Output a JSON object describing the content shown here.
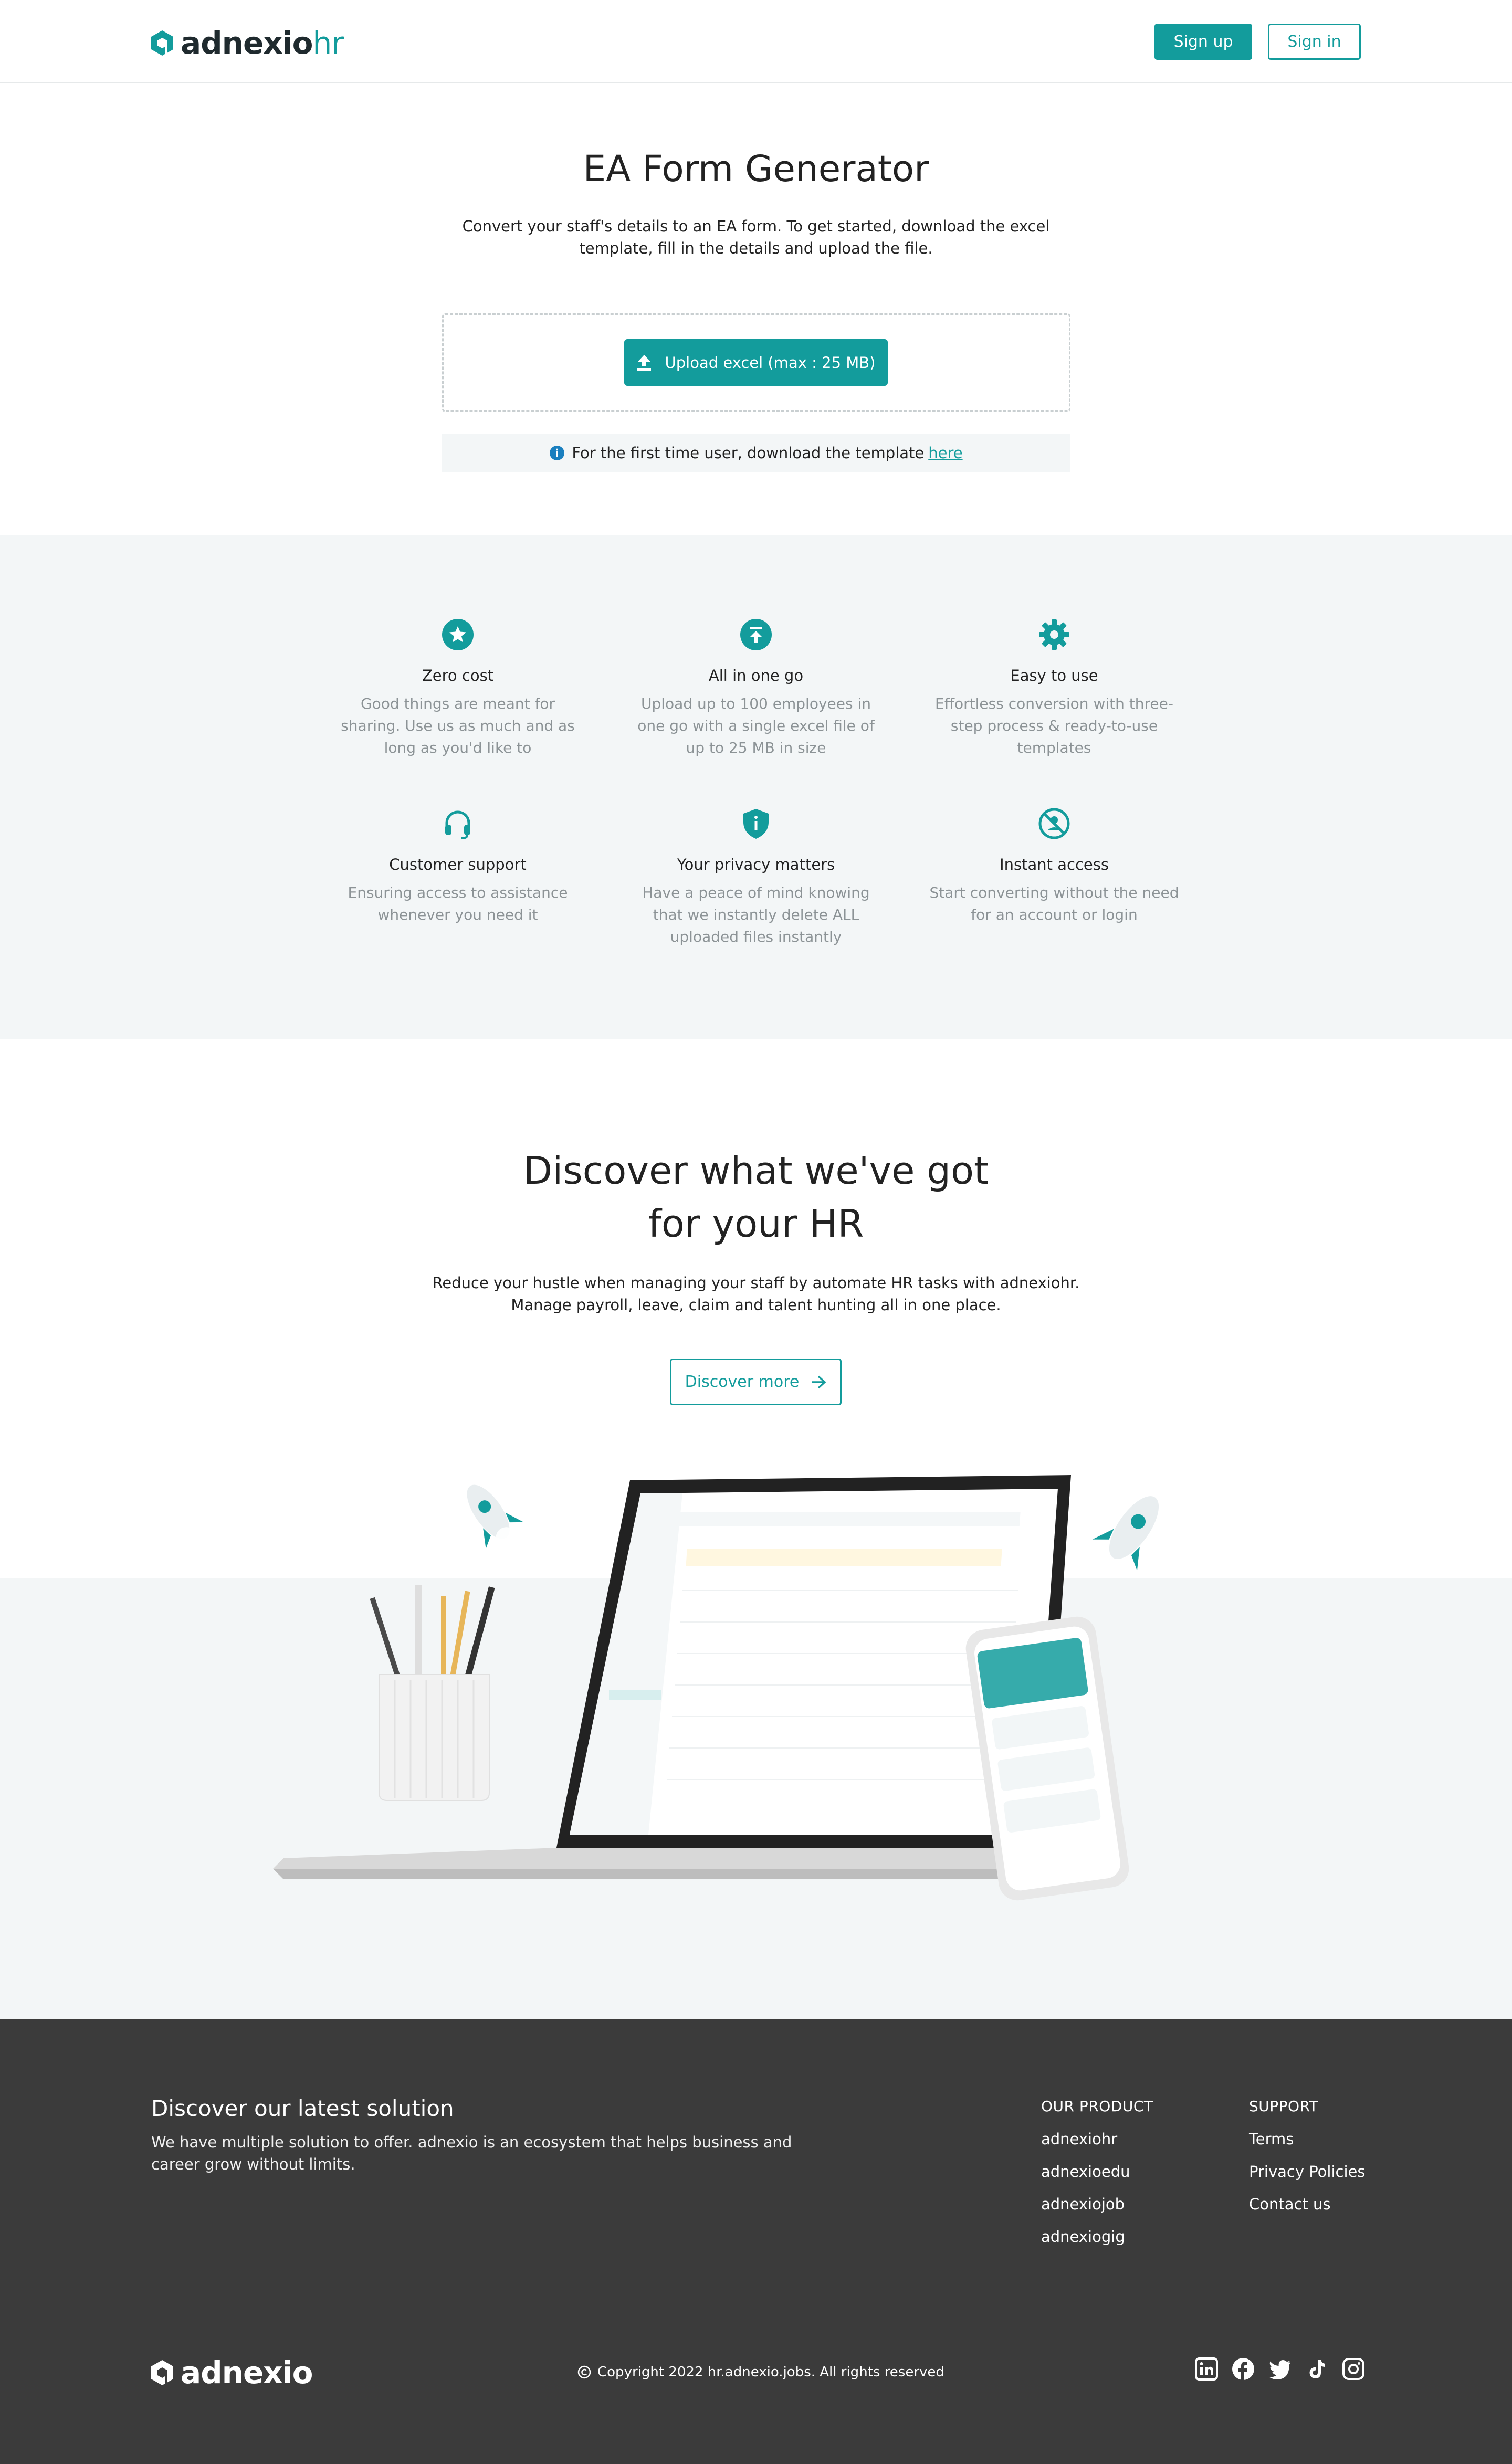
{
  "header": {
    "logo": {
      "main": "adnexio",
      "sub": "hr"
    },
    "signup_label": "Sign up",
    "signin_label": "Sign in"
  },
  "hero": {
    "title": "EA Form Generator",
    "subtitle_line1": "Convert your staff's details to an EA form. To get started, download the excel",
    "subtitle_line2": "template, fill in the details and upload the file.",
    "upload_label": "Upload excel (max : 25 MB)",
    "info_text": "For the first time user, download the template",
    "info_link": "here"
  },
  "features": [
    {
      "icon": "star-badge-icon",
      "title": "Zero cost",
      "desc_lines": [
        "Good things are meant for",
        "sharing. Use us as much and as",
        "long as you'd like to"
      ]
    },
    {
      "icon": "upload-circle-icon",
      "title": "All in one go",
      "desc_lines": [
        "Upload up to 100 employees in",
        "one go with a single excel file of",
        "up to 25 MB in size"
      ]
    },
    {
      "icon": "gear-icon",
      "title": "Easy to use",
      "desc_lines": [
        "Effortless conversion with three-",
        "step process & ready-to-use",
        "templates"
      ]
    },
    {
      "icon": "headset-icon",
      "title": "Customer support",
      "desc_lines": [
        "Ensuring access to assistance",
        "whenever you need it"
      ]
    },
    {
      "icon": "shield-info-icon",
      "title": "Your privacy matters",
      "desc_lines": [
        "Have a peace of mind knowing",
        "that we instantly delete ALL",
        "uploaded files instantly"
      ]
    },
    {
      "icon": "no-account-icon",
      "title": "Instant access",
      "desc_lines": [
        "Start converting without the need",
        "for an account or login"
      ]
    }
  ],
  "discover": {
    "title_line1": "Discover what we've got",
    "title_line2": "for your HR",
    "sub_line1": "Reduce your hustle when managing your staff by automate HR tasks with adnexiohr.",
    "sub_line2": "Manage payroll, leave, claim and talent hunting all in one place.",
    "button_label": "Discover more"
  },
  "footer": {
    "title": "Discover our latest solution",
    "desc_line1": "We have multiple solution to offer. adnexio is an ecosystem that helps business and",
    "desc_line2": "career grow without limits.",
    "product": {
      "heading": "OUR PRODUCT",
      "links": [
        "adnexiohr",
        "adnexioedu",
        "adnexiojob",
        "adnexiogig"
      ]
    },
    "support": {
      "heading": "SUPPORT",
      "links": [
        "Terms",
        "Privacy Policies",
        "Contact us"
      ]
    },
    "logo": "adnexio",
    "copyright": "Copyright 2022 hr.adnexio.jobs. All rights reserved",
    "socials": [
      "linkedin-icon",
      "facebook-icon",
      "twitter-icon",
      "tiktok-icon",
      "instagram-icon"
    ]
  },
  "colors": {
    "brand": "#139c9c",
    "footer_bg": "#3b3b3b",
    "section_bg": "#f3f6f7"
  }
}
